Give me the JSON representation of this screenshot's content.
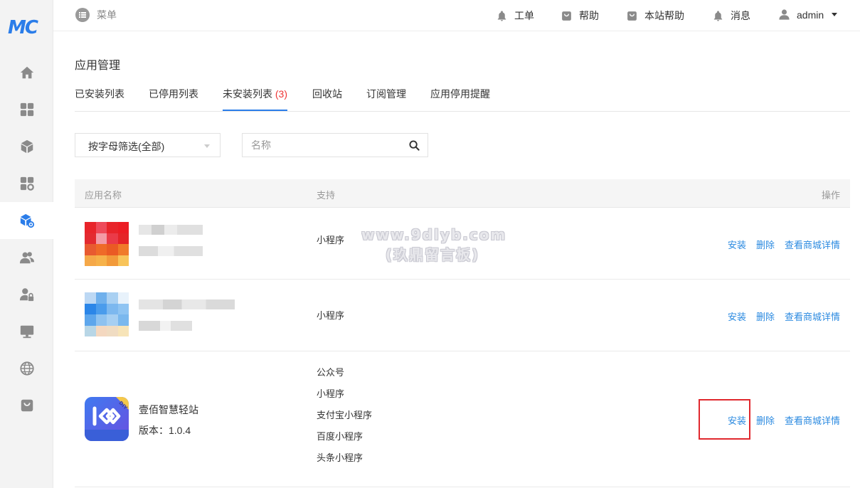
{
  "logo": {
    "text": "MC"
  },
  "sidebar": {
    "items": [
      {
        "icon": "home-icon"
      },
      {
        "icon": "grid-apps-icon"
      },
      {
        "icon": "cube-icon"
      },
      {
        "icon": "apps-settings-icon"
      },
      {
        "icon": "cube-settings-icon",
        "active": true
      },
      {
        "icon": "users-icon"
      },
      {
        "icon": "user-lock-icon"
      },
      {
        "icon": "monitor-icon"
      },
      {
        "icon": "globe-icon"
      },
      {
        "icon": "shop-bag-icon"
      }
    ]
  },
  "topbar": {
    "menu_label": "菜单",
    "items": [
      {
        "icon": "bell-icon",
        "label": "工单"
      },
      {
        "icon": "bag-icon",
        "label": "帮助"
      },
      {
        "icon": "bag-icon",
        "label": "本站帮助"
      },
      {
        "icon": "bell-icon",
        "label": "消息"
      },
      {
        "icon": "user-icon",
        "label": "admin"
      }
    ]
  },
  "page_title": "应用管理",
  "tabs": [
    {
      "label": "已安装列表"
    },
    {
      "label": "已停用列表"
    },
    {
      "label": "未安装列表",
      "count": "(3)",
      "active": true
    },
    {
      "label": "回收站"
    },
    {
      "label": "订阅管理"
    },
    {
      "label": "应用停用提醒"
    }
  ],
  "filters": {
    "letter_select": "按字母筛选(全部)",
    "search_placeholder": "名称"
  },
  "table": {
    "headers": {
      "name": "应用名称",
      "support": "支持",
      "actions": "操作"
    },
    "rows": [
      {
        "name": "",
        "version": "",
        "support": [
          "小程序"
        ],
        "actions": {
          "install": "安装",
          "delete": "删除",
          "detail": "查看商城详情"
        }
      },
      {
        "name": "",
        "version": "",
        "support": [
          "小程序"
        ],
        "actions": {
          "install": "安装",
          "delete": "删除",
          "detail": "查看商城详情"
        }
      },
      {
        "name": "壹佰智慧轻站",
        "version": "版本：1.0.4",
        "support": [
          "公众号",
          "小程序",
          "支付宝小程序",
          "百度小程序",
          "头条小程序"
        ],
        "actions": {
          "install": "安装",
          "delete": "删除",
          "detail": "查看商城详情"
        }
      }
    ]
  },
  "watermark": {
    "line1": "www.9dlyb.com",
    "line2": "(玖鼎留言板)"
  },
  "colors": {
    "accent": "#2b7de9",
    "link": "#2b8ae0",
    "highlight": "#e0282e",
    "count": "#ee3333"
  }
}
